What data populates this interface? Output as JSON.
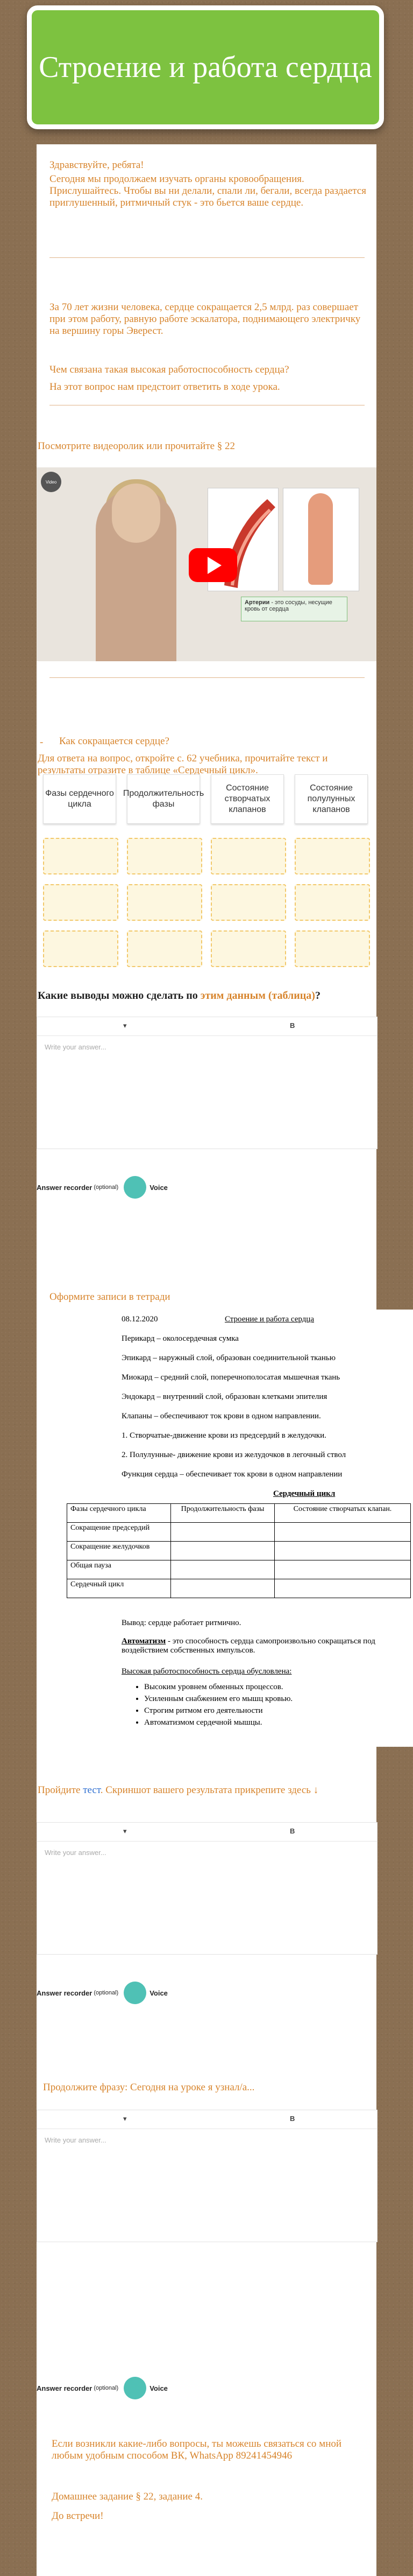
{
  "header": {
    "title": "Строение и работа сердца"
  },
  "intro": {
    "greeting": "Здравствуйте, ребята!",
    "text": "Сегодня мы продолжаем изучать органы кровообращения. Прислушайтесь. Чтобы вы ни делали, спали ли, бегали, всегда раздается приглушенный, ритмичный стук - это бьется ваше сердце."
  },
  "facts": {
    "line1": "За 70 лет жизни человека, сердце сокращается 2,5 млрд. раз совершает при этом работу, равную работе эскалатора, поднимающего электричку на вершину горы Эверест.",
    "line2": "Чем связана такая высокая работоспособность сердца?",
    "line3": "На этот вопрос нам предстоит ответить в ходе урока."
  },
  "video_section": {
    "heading": "Посмотрите видеоролик или прочитайте § 22",
    "caption_bold": "Артерии",
    "caption_text": " - это сосуды, несущие кровь от сердца",
    "channel_label": "Video"
  },
  "task": {
    "bullet": "-",
    "question": "Как сокращается сердце?",
    "instruction": "Для ответа на вопрос, откройте с. 62 учебника, прочитайте текст и результаты отразите в таблице «Сердечный цикл».",
    "columns": [
      "Фазы сердечного цикла",
      "Продолжительность фазы",
      "Состояние створчатых клапанов",
      "Состояние полулунных клапанов"
    ]
  },
  "answer1": {
    "title_prefix": "Какие выводы можно сделать по ",
    "title_link": "этим данным (таблица)",
    "title_suffix": "?",
    "toolbar_left": "▾",
    "toolbar_right": "B",
    "placeholder": "Write your answer...",
    "recorder_label": "Answer recorder",
    "recorder_optional": "(optional)",
    "voice_label": "Voice"
  },
  "notes": {
    "heading": "Оформите записи в тетради"
  },
  "document": {
    "date": "08.12.2020",
    "title": "Строение и работа сердца",
    "lines": [
      "Перикард – околосердечная сумка",
      "Эпикард – наружный слой, образован соединительной тканью",
      "Миокард – средний слой, поперечнополосатая мышечная ткань",
      "Эндокард – внутренний слой, образован клетками эпителия",
      "Клапаны – обеспечивают ток крови в одном направлении.",
      "1. Створчатые-движение крови из предсердий в желудочки.",
      "2. Полулунные- движение крови из желудочков в легочный ствол",
      "Функция сердца – обеспечивает ток крови в одном направлении"
    ],
    "table_title": "Сердечный цикл",
    "table_headers": [
      "Фазы сердечного цикла",
      "Продолжительность фазы",
      "Состояние створчатых клапан."
    ],
    "table_rows": [
      "Сокращение предсердий",
      "Сокращение желудочков",
      "Общая пауза",
      "Сердечный цикл"
    ],
    "conclusion": "Вывод: сердце работает ритмично.",
    "automatism_term": "Автоматизм",
    "automatism_text": " - это способность сердца самопроизвольно сокращаться под воздействием собственных импульсов.",
    "capacity_title": "Высокая работоспособность сердца обусловлена:",
    "bullets": [
      "Высоким уровнем обменных процессов.",
      "Усиленным снабжением его мышц кровью.",
      "Строгим ритмом его деятельности",
      "Автоматизмом сердечной мышцы."
    ]
  },
  "test_section": {
    "text_prefix": "Пройдите ",
    "link": "тест",
    "text_suffix": ". Скриншот вашего результата прикрепите здесь ↓"
  },
  "answer2": {
    "toolbar_left": "▾",
    "toolbar_right": "B",
    "placeholder": "Write your answer...",
    "recorder_label": "Answer recorder",
    "recorder_optional": "(optional)",
    "voice_label": "Voice"
  },
  "continue_section": {
    "text": "Продолжите фразу: Сегодня на уроке я узнал/а..."
  },
  "answer3": {
    "toolbar_left": "▾",
    "toolbar_right": "B",
    "placeholder": "Write your answer...",
    "recorder_label": "Answer recorder",
    "recorder_optional": "(optional)",
    "voice_label": "Voice"
  },
  "footer": {
    "contact": "Если возникли какие-либо вопросы, ты можешь связаться со мной любым удобным способом ВК, WhatsApp 89241454946",
    "homework": "Домашнее задание § 22, задание 4.",
    "goodbye": "До встречи!"
  },
  "colors": {
    "accent": "#d7842c",
    "header_green": "#7dc240",
    "voice": "#4fc1b5",
    "link": "#2f6fd1"
  }
}
